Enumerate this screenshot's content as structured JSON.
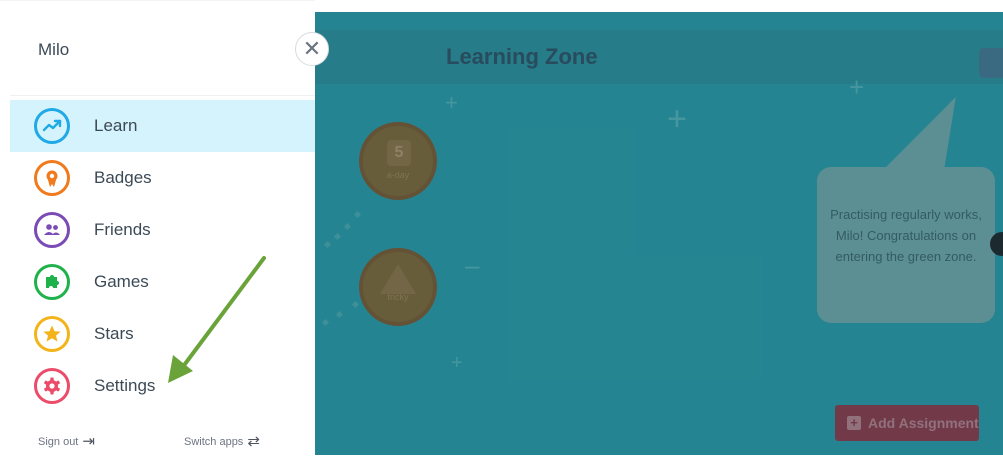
{
  "app": {
    "title": "Learning Zone",
    "bubble_text": "Practising regularly works, Milo! Congratulations on entering the green zone.",
    "node_day": "5",
    "node_day_label": "a-day",
    "node_tricky_symbol": "?",
    "node_tricky_label": "tricky",
    "add_button_label": "Add Assignment",
    "add_button_icon": "+"
  },
  "drawer": {
    "user_name": "Milo",
    "close_symbol": "✕",
    "items": [
      {
        "label": "Learn",
        "icon": "trend-up-icon",
        "color": "#1fa9e6",
        "active": true
      },
      {
        "label": "Badges",
        "icon": "ribbon-icon",
        "color": "#f07a1c"
      },
      {
        "label": "Friends",
        "icon": "people-icon",
        "color": "#7b4bb5"
      },
      {
        "label": "Games",
        "icon": "puzzle-icon",
        "color": "#20b24a"
      },
      {
        "label": "Stars",
        "icon": "star-icon",
        "color": "#f3b41b"
      },
      {
        "label": "Settings",
        "icon": "gear-icon",
        "color": "#ea4c6a"
      }
    ],
    "sign_out": "Sign out",
    "sign_out_symbol": "⇥",
    "switch_apps": "Switch apps",
    "switch_apps_symbol": "⇄"
  },
  "annotation_color": "#6aa33a"
}
